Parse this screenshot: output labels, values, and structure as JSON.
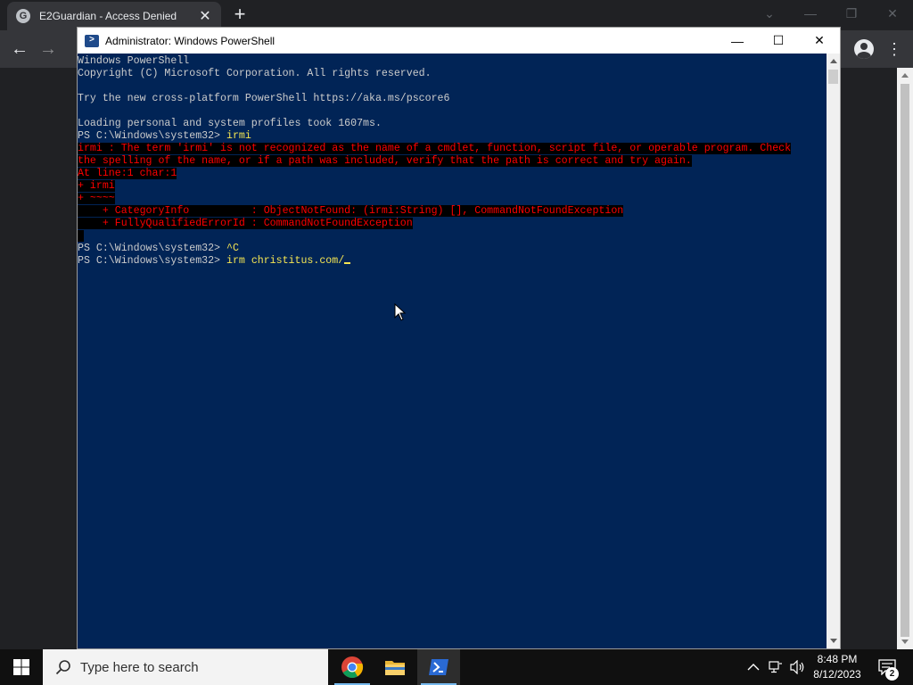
{
  "browser": {
    "tab_title": "E2Guardian - Access Denied",
    "favicon_letter": "G",
    "tab_close_glyph": "✕",
    "new_tab_glyph": "+",
    "back_glyph": "←",
    "forward_glyph": "→",
    "menu_glyph": "⋮",
    "window_controls": {
      "dropdown": "⌄",
      "minimize": "—",
      "restore": "❐",
      "close": "✕"
    }
  },
  "powershell": {
    "title": "Administrator: Windows PowerShell",
    "controls": {
      "minimize": "—",
      "maximize": "☐",
      "close": "✕"
    },
    "lines": [
      {
        "style": "normal",
        "text": "Windows PowerShell"
      },
      {
        "style": "normal",
        "text": "Copyright (C) Microsoft Corporation. All rights reserved."
      },
      {
        "style": "normal",
        "text": ""
      },
      {
        "style": "normal",
        "text": "Try the new cross-platform PowerShell https://aka.ms/pscore6"
      },
      {
        "style": "normal",
        "text": ""
      },
      {
        "style": "normal",
        "text": "Loading personal and system profiles took 1607ms."
      },
      {
        "style": "prompt",
        "prompt": "PS C:\\Windows\\system32> ",
        "cmd": "irmi"
      },
      {
        "style": "error",
        "text": "irmi : The term 'irmi' is not recognized as the name of a cmdlet, function, script file, or operable program. Check"
      },
      {
        "style": "error",
        "text": "the spelling of the name, or if a path was included, verify that the path is correct and try again."
      },
      {
        "style": "error",
        "text": "At line:1 char:1"
      },
      {
        "style": "error",
        "text": "+ irmi"
      },
      {
        "style": "error",
        "text": "+ ~~~~"
      },
      {
        "style": "error",
        "text": "    + CategoryInfo          : ObjectNotFound: (irmi:String) [], CommandNotFoundException"
      },
      {
        "style": "error",
        "text": "    + FullyQualifiedErrorId : CommandNotFoundException"
      },
      {
        "style": "error",
        "text": " "
      },
      {
        "style": "prompt",
        "prompt": "PS C:\\Windows\\system32> ",
        "cmd": "^C"
      },
      {
        "style": "prompt-cursor",
        "prompt": "PS C:\\Windows\\system32> ",
        "cmd": "irm christitus.com/"
      }
    ]
  },
  "taskbar": {
    "search_placeholder": "Type here to search",
    "clock_time": "8:48 PM",
    "clock_date": "8/12/2023",
    "notification_count": "2"
  }
}
